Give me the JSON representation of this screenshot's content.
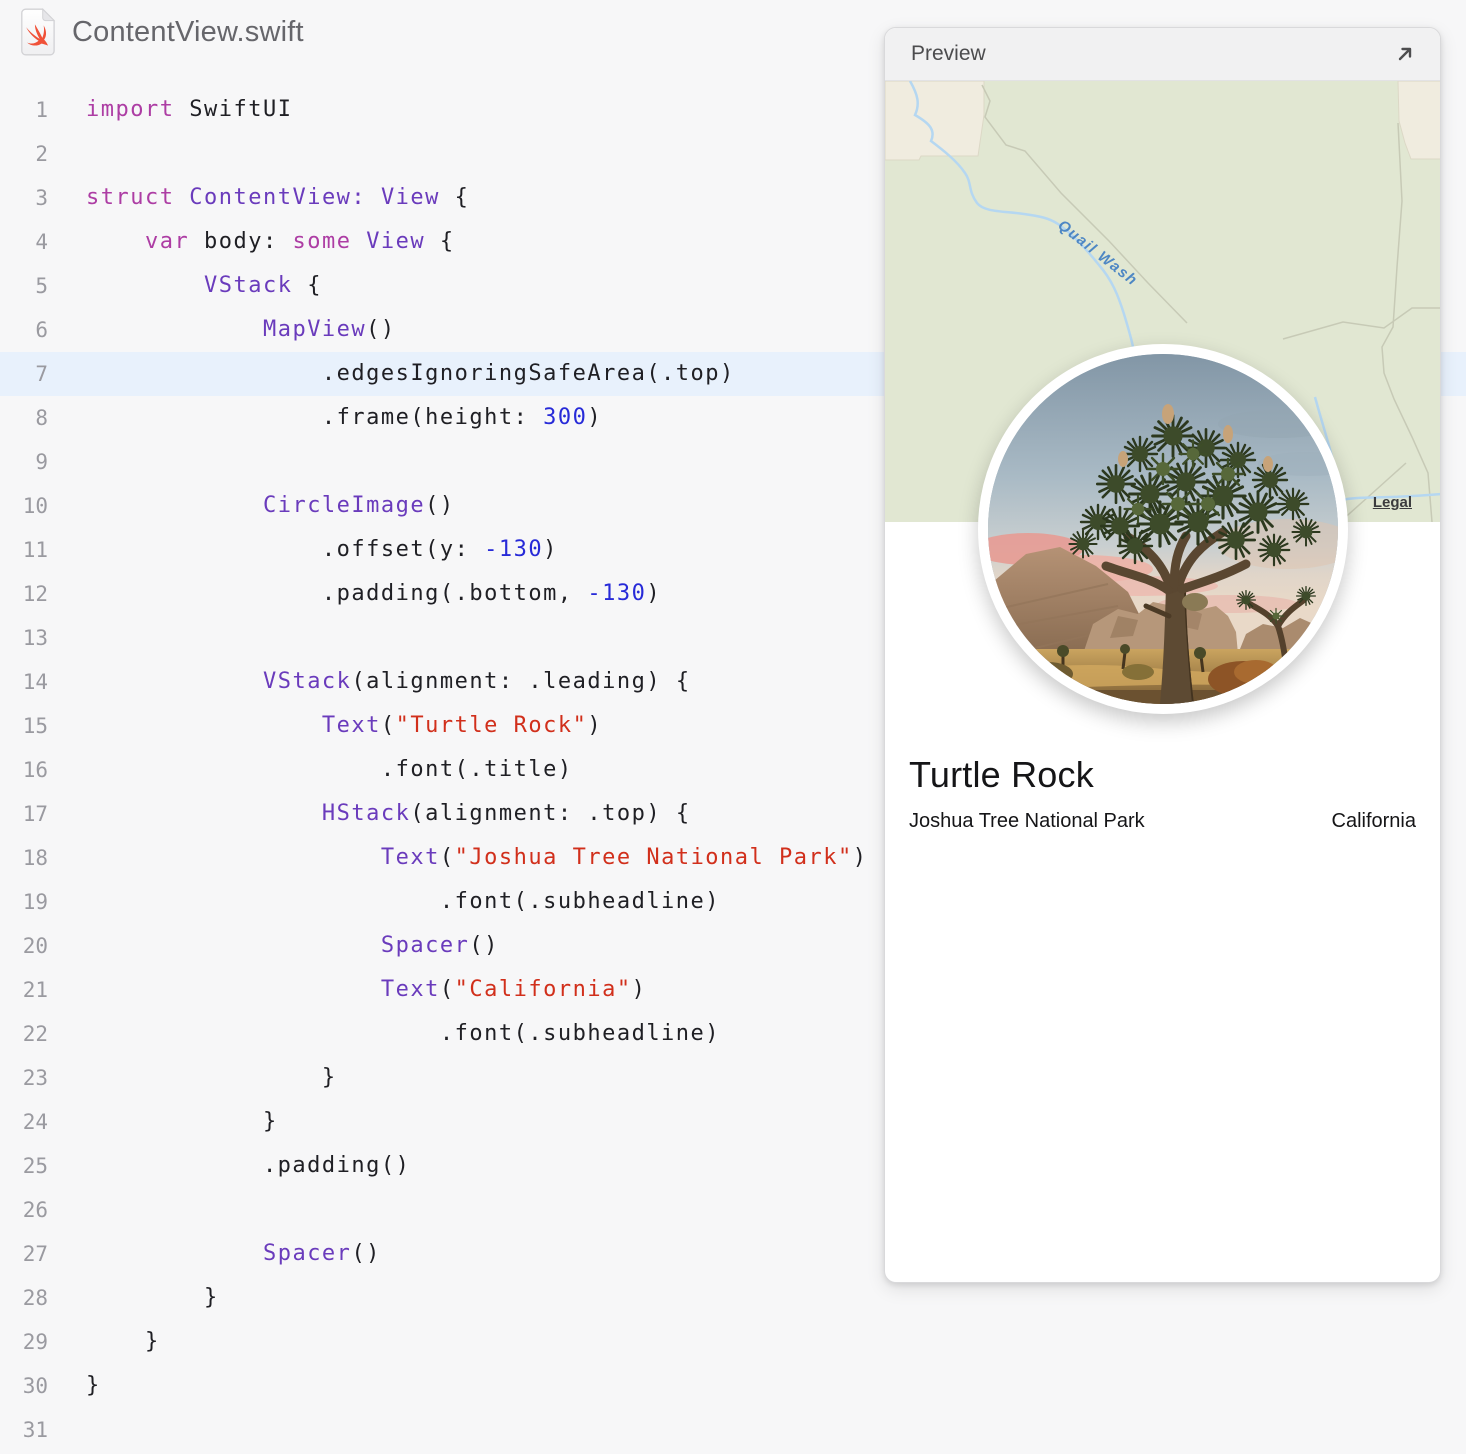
{
  "file_header": {
    "title": "ContentView.swift"
  },
  "colors": {
    "editor_bg": "#f7f7f8",
    "line_highlight": "#e8f1fc",
    "keyword": "#ad3da4",
    "type": "#6a3bbc",
    "string": "#d12f1b",
    "number": "#272ad8",
    "plain": "#1f1f24",
    "swift_orange": "#f05138",
    "map_green": "#e1e7d2",
    "map_beige": "#f0ecdf",
    "stream_blue": "#b5d7f1",
    "stream_label_blue": "#4e87c4"
  },
  "code": {
    "highlighted_line": 7,
    "lines": [
      {
        "n": 1,
        "seg": [
          [
            "kw",
            "import"
          ],
          [
            "pl",
            " SwiftUI"
          ]
        ]
      },
      {
        "n": 2,
        "seg": []
      },
      {
        "n": 3,
        "seg": [
          [
            "kw",
            "struct"
          ],
          [
            "pl",
            " "
          ],
          [
            "ty",
            "ContentView:"
          ],
          [
            "pl",
            " "
          ],
          [
            "ty",
            "View"
          ],
          [
            "pl",
            " {"
          ]
        ]
      },
      {
        "n": 4,
        "seg": [
          [
            "pl",
            "    "
          ],
          [
            "kw",
            "var"
          ],
          [
            "pl",
            " body: "
          ],
          [
            "kw",
            "some"
          ],
          [
            "pl",
            " "
          ],
          [
            "ty",
            "View"
          ],
          [
            "pl",
            " {"
          ]
        ]
      },
      {
        "n": 5,
        "seg": [
          [
            "pl",
            "        "
          ],
          [
            "ty",
            "VStack"
          ],
          [
            "pl",
            " {"
          ]
        ]
      },
      {
        "n": 6,
        "seg": [
          [
            "pl",
            "            "
          ],
          [
            "ty",
            "MapView"
          ],
          [
            "pl",
            "()"
          ]
        ]
      },
      {
        "n": 7,
        "hl": true,
        "seg": [
          [
            "pl",
            "                .edgesIgnoringSafeArea(.top)"
          ]
        ]
      },
      {
        "n": 8,
        "seg": [
          [
            "pl",
            "                .frame(height: "
          ],
          [
            "nu",
            "300"
          ],
          [
            "pl",
            ")"
          ]
        ]
      },
      {
        "n": 9,
        "seg": []
      },
      {
        "n": 10,
        "seg": [
          [
            "pl",
            "            "
          ],
          [
            "ty",
            "CircleImage"
          ],
          [
            "pl",
            "()"
          ]
        ]
      },
      {
        "n": 11,
        "seg": [
          [
            "pl",
            "                .offset(y: "
          ],
          [
            "nu",
            "-130"
          ],
          [
            "pl",
            ")"
          ]
        ]
      },
      {
        "n": 12,
        "seg": [
          [
            "pl",
            "                .padding(.bottom, "
          ],
          [
            "nu",
            "-130"
          ],
          [
            "pl",
            ")"
          ]
        ]
      },
      {
        "n": 13,
        "seg": []
      },
      {
        "n": 14,
        "seg": [
          [
            "pl",
            "            "
          ],
          [
            "ty",
            "VStack"
          ],
          [
            "pl",
            "(alignment: .leading) {"
          ]
        ]
      },
      {
        "n": 15,
        "seg": [
          [
            "pl",
            "                "
          ],
          [
            "ty",
            "Text"
          ],
          [
            "pl",
            "("
          ],
          [
            "st",
            "\"Turtle Rock\""
          ],
          [
            "pl",
            ")"
          ]
        ]
      },
      {
        "n": 16,
        "seg": [
          [
            "pl",
            "                    .font(.title)"
          ]
        ]
      },
      {
        "n": 17,
        "seg": [
          [
            "pl",
            "                "
          ],
          [
            "ty",
            "HStack"
          ],
          [
            "pl",
            "(alignment: .top) {"
          ]
        ]
      },
      {
        "n": 18,
        "seg": [
          [
            "pl",
            "                    "
          ],
          [
            "ty",
            "Text"
          ],
          [
            "pl",
            "("
          ],
          [
            "st",
            "\"Joshua Tree National Park\""
          ],
          [
            "pl",
            ")"
          ]
        ]
      },
      {
        "n": 19,
        "seg": [
          [
            "pl",
            "                        .font(.subheadline)"
          ]
        ]
      },
      {
        "n": 20,
        "seg": [
          [
            "pl",
            "                    "
          ],
          [
            "ty",
            "Spacer"
          ],
          [
            "pl",
            "()"
          ]
        ]
      },
      {
        "n": 21,
        "seg": [
          [
            "pl",
            "                    "
          ],
          [
            "ty",
            "Text"
          ],
          [
            "pl",
            "("
          ],
          [
            "st",
            "\"California\""
          ],
          [
            "pl",
            ")"
          ]
        ]
      },
      {
        "n": 22,
        "seg": [
          [
            "pl",
            "                        .font(.subheadline)"
          ]
        ]
      },
      {
        "n": 23,
        "seg": [
          [
            "pl",
            "                }"
          ]
        ]
      },
      {
        "n": 24,
        "seg": [
          [
            "pl",
            "            }"
          ]
        ]
      },
      {
        "n": 25,
        "seg": [
          [
            "pl",
            "            .padding()"
          ]
        ]
      },
      {
        "n": 26,
        "seg": []
      },
      {
        "n": 27,
        "seg": [
          [
            "pl",
            "            "
          ],
          [
            "ty",
            "Spacer"
          ],
          [
            "pl",
            "()"
          ]
        ]
      },
      {
        "n": 28,
        "seg": [
          [
            "pl",
            "        }"
          ]
        ]
      },
      {
        "n": 29,
        "seg": [
          [
            "pl",
            "    }"
          ]
        ]
      },
      {
        "n": 30,
        "seg": [
          [
            "pl",
            "}"
          ]
        ]
      },
      {
        "n": 31,
        "seg": []
      }
    ]
  },
  "preview": {
    "header": {
      "title": "Preview"
    },
    "map": {
      "stream_label": "Quail Wash",
      "legal_label": "Legal"
    },
    "place": {
      "title": "Turtle Rock",
      "park": "Joshua Tree National Park",
      "state": "California"
    }
  }
}
